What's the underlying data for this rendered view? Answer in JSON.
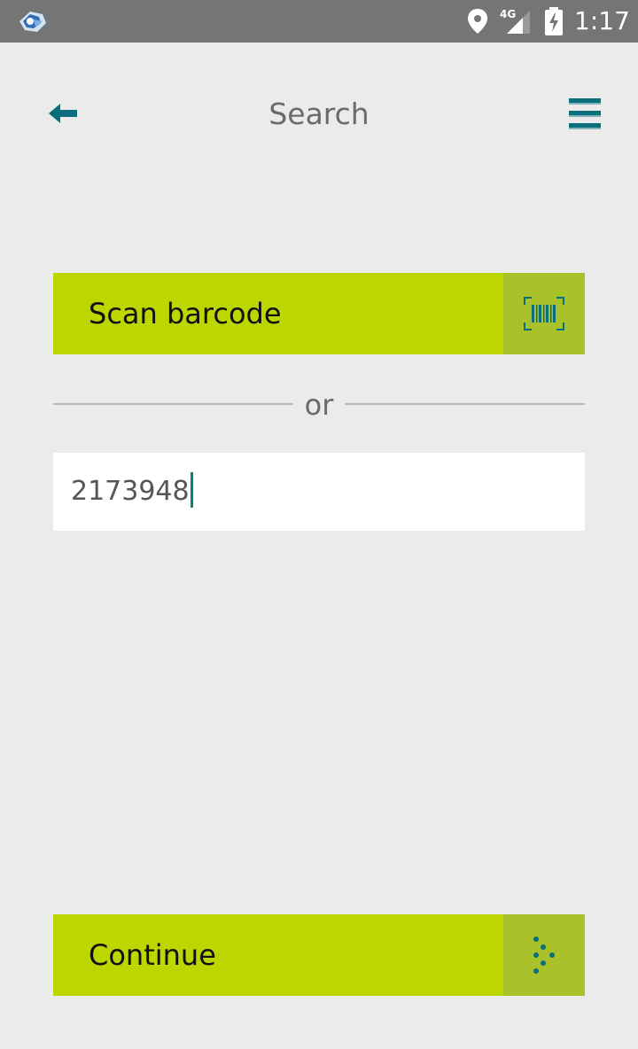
{
  "status_bar": {
    "time": "1:17",
    "network": "4G",
    "icons": [
      "app-notification-icon",
      "location-icon",
      "signal-icon",
      "battery-charging-icon"
    ]
  },
  "header": {
    "title": "Search",
    "back_icon": "arrow-left-icon",
    "menu_icon": "hamburger-menu-icon"
  },
  "scan": {
    "label": "Scan barcode",
    "icon": "barcode-icon"
  },
  "divider": {
    "text": "or"
  },
  "search": {
    "value": "2173948"
  },
  "continue": {
    "label": "Continue",
    "icon": "dotted-arrow-icon"
  },
  "colors": {
    "accent": "#bed600",
    "accent_dark": "#a9c22a",
    "icon_teal": "#0a6e7c",
    "status_bar": "#757575",
    "background": "#ebebeb"
  }
}
